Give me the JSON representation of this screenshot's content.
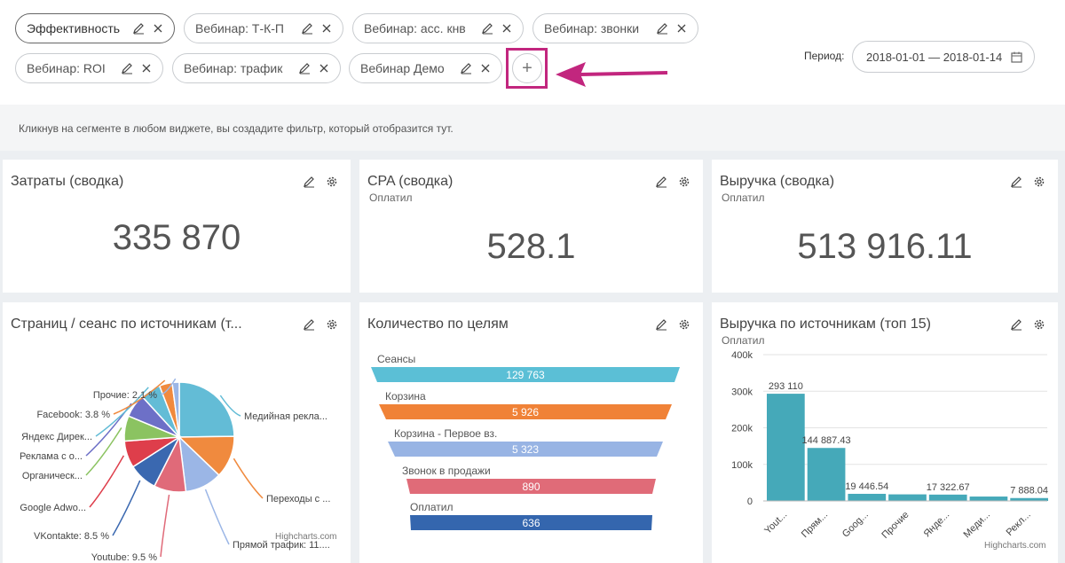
{
  "filters": [
    {
      "label": "Эффективность",
      "active": true
    },
    {
      "label": "Вебинар: Т-К-П"
    },
    {
      "label": "Вебинар: асс. кнв"
    },
    {
      "label": "Вебинар: звонки"
    },
    {
      "label": "Вебинар: ROI"
    },
    {
      "label": "Вебинар: трафик"
    },
    {
      "label": "Вебинар Демо"
    }
  ],
  "add_button": "+",
  "period": {
    "label": "Период:",
    "value": "2018-01-01 — 2018-01-14"
  },
  "hint": "Кликнув на сегменте в любом виджете, вы создадите фильтр, который отобразится тут.",
  "colors": {
    "accent_arrow": "#c2267e"
  },
  "widgets": {
    "costs": {
      "title": "Затраты (сводка)",
      "value": "335 870"
    },
    "cpa": {
      "title": "CPA (сводка)",
      "subtitle": "Оплатил",
      "value": "528.1"
    },
    "revenue": {
      "title": "Выручка (сводка)",
      "subtitle": "Оплатил",
      "value": "513 916.11"
    },
    "pages": {
      "title": "Страниц / сеанс по источникам (т...",
      "credit": "Highcharts.com"
    },
    "goals": {
      "title": "Количество по целям"
    },
    "rev_sources": {
      "title": "Выручка по источникам (топ 15)",
      "subtitle": "Оплатил",
      "credit": "Highcharts.com"
    }
  },
  "chart_data": [
    {
      "type": "pie",
      "title": "Страниц / сеанс по источникам (т...",
      "slice_labels": [
        "Медийная рекла...",
        "Переходы с ...",
        "Прямой трафик: 11....",
        "Youtube: 9.5 %",
        "VKontakte: 8.5 %",
        "Google Adwo...",
        "Органическ...",
        "Реклама с о...",
        "Яндекс Дирек...",
        "Facebook: 3.8 %",
        "Прочие: 2.1 %"
      ],
      "values": [
        25.0,
        12.5,
        11.0,
        9.5,
        8.5,
        8.0,
        7.5,
        7.0,
        6.0,
        3.8,
        2.1
      ],
      "colors": [
        "#63bcd6",
        "#f08a3e",
        "#9bb6e6",
        "#e06a79",
        "#3a68b0",
        "#de3e4b",
        "#8bc361",
        "#6d70c7",
        "#63bcd6",
        "#f08a3e",
        "#9bb6e6"
      ]
    },
    {
      "type": "funnel",
      "title": "Количество по целям",
      "categories": [
        "Сеансы",
        "Корзина",
        "Корзина - Первое вз.",
        "Звонок в продажи",
        "Оплатил"
      ],
      "values": [
        129763,
        5926,
        5323,
        890,
        636
      ],
      "value_labels": [
        "129 763",
        "5 926",
        "5 323",
        "890",
        "636"
      ],
      "colors": [
        "#5bbfd6",
        "#f08237",
        "#98b4e4",
        "#e06b78",
        "#3466ae"
      ]
    },
    {
      "type": "bar",
      "title": "Выручка по источникам (топ 15)",
      "subtitle": "Оплатил",
      "categories": [
        "Yout...",
        "Прям...",
        "Goog...",
        "Прочие",
        "Янде...",
        "Меди...",
        "Рекл..."
      ],
      "values": [
        293110,
        144887.43,
        19446.54,
        18000,
        17322.67,
        12000,
        7888.04
      ],
      "data_labels": [
        "293 110",
        "144 887.43",
        "19 446.54",
        "",
        "17 322.67",
        "",
        "7 888.04"
      ],
      "ylim": [
        0,
        400000
      ],
      "yticks": [
        "0",
        "100k",
        "200k",
        "300k",
        "400k"
      ],
      "color": "#45a9b9"
    }
  ]
}
